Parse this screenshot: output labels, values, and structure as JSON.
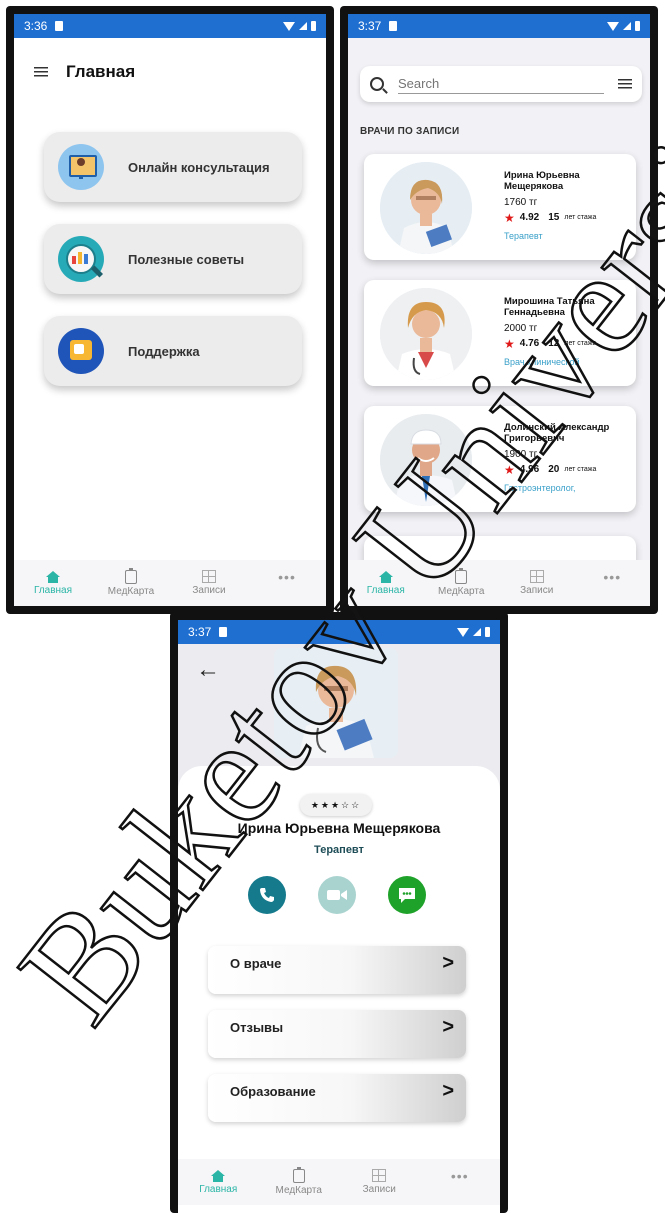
{
  "screen1": {
    "time": "3:36",
    "title": "Главная",
    "menu": [
      {
        "label": "Онлайн консультация",
        "icon": "consultation-icon"
      },
      {
        "label": "Полезные советы",
        "icon": "tips-magnifier-icon"
      },
      {
        "label": "Поддержка",
        "icon": "support-thumbs-up-icon"
      }
    ]
  },
  "screen2": {
    "time": "3:37",
    "search_placeholder": "Search",
    "section_title": "ВРАЧИ ПО ЗАПИСИ",
    "doctors": [
      {
        "name": "Ирина Юрьевна Мещерякова",
        "price": "1760  тг",
        "rating": "4.92",
        "years": "15",
        "years_label": "лет стажа",
        "specialty": "Терапевт"
      },
      {
        "name": "Мирошина Татьяна Геннадьевна",
        "price": "2000  тг",
        "rating": "4.76",
        "years": "12",
        "years_label": "лет стажа",
        "specialty": "Врач клинической"
      },
      {
        "name": "Долинский Александр Григорьевич",
        "price": "1900  тг",
        "rating": "4.96",
        "years": "20",
        "years_label": "лет стажа",
        "specialty": "Гастроэнтеролог,"
      }
    ]
  },
  "screen3": {
    "time": "3:37",
    "stars": "★★★☆☆",
    "rating_value": 3,
    "name": "Ирина Юрьевна Мещерякова",
    "specialty": "Терапевт",
    "actions": [
      "call-icon",
      "video-icon",
      "chat-icon"
    ],
    "rows": [
      "О враче",
      "Отзывы",
      "Образование"
    ]
  },
  "nav": [
    "Главная",
    "МедКарта",
    "Записи"
  ],
  "watermark": "Buketov University",
  "colors": {
    "statusbar": "#1f6fd1",
    "accent": "#2bb5a6",
    "rating_star": "#e01818",
    "specialty_link": "#3aa0c9",
    "call": "#157a8c",
    "video": "#a9d3cf",
    "chat": "#1fa22a"
  }
}
